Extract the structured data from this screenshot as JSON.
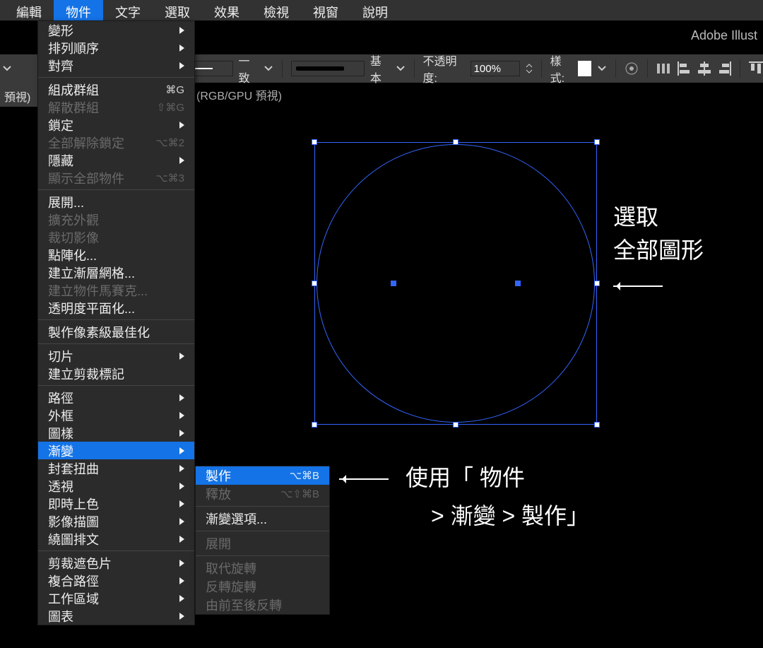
{
  "menubar": [
    "編輯",
    "物件",
    "文字",
    "選取",
    "效果",
    "檢視",
    "視窗",
    "說明"
  ],
  "activeMenuIndex": 1,
  "brand": "Adobe Illust",
  "options": {
    "uniform": "一致",
    "brush": "基本",
    "opacityLabel": "不透明度:",
    "opacityValue": "100%",
    "styleLabel": "樣式:"
  },
  "tab": {
    "left": "預視)",
    "right": "(RGB/GPU 預視)"
  },
  "menu": {
    "groups": [
      [
        {
          "l": "變形",
          "sub": true
        },
        {
          "l": "排列順序",
          "sub": true
        },
        {
          "l": "對齊",
          "sub": true
        }
      ],
      [
        {
          "l": "組成群組",
          "sc": "⌘G"
        },
        {
          "l": "解散群組",
          "sc": "⇧⌘G",
          "dis": true
        },
        {
          "l": "鎖定",
          "sub": true
        },
        {
          "l": "全部解除鎖定",
          "sc": "⌥⌘2",
          "dis": true
        },
        {
          "l": "隱藏",
          "sub": true
        },
        {
          "l": "顯示全部物件",
          "sc": "⌥⌘3",
          "dis": true
        }
      ],
      [
        {
          "l": "展開..."
        },
        {
          "l": "擴充外觀",
          "dis": true
        },
        {
          "l": "裁切影像",
          "dis": true
        },
        {
          "l": "點陣化..."
        },
        {
          "l": "建立漸層網格..."
        },
        {
          "l": "建立物件馬賽克...",
          "dis": true
        },
        {
          "l": "透明度平面化..."
        }
      ],
      [
        {
          "l": "製作像素級最佳化"
        }
      ],
      [
        {
          "l": "切片",
          "sub": true
        },
        {
          "l": "建立剪裁標記"
        }
      ],
      [
        {
          "l": "路徑",
          "sub": true
        },
        {
          "l": "外框",
          "sub": true
        },
        {
          "l": "圖樣",
          "sub": true
        },
        {
          "l": "漸變",
          "sub": true,
          "hl": true
        },
        {
          "l": "封套扭曲",
          "sub": true
        },
        {
          "l": "透視",
          "sub": true
        },
        {
          "l": "即時上色",
          "sub": true
        },
        {
          "l": "影像描圖",
          "sub": true
        },
        {
          "l": "繞圖排文",
          "sub": true
        }
      ],
      [
        {
          "l": "剪裁遮色片",
          "sub": true
        },
        {
          "l": "複合路徑",
          "sub": true
        },
        {
          "l": "工作區域",
          "sub": true
        },
        {
          "l": "圖表",
          "sub": true
        }
      ]
    ]
  },
  "submenu": [
    {
      "l": "製作",
      "sc": "⌥⌘B",
      "hl": true
    },
    {
      "l": "釋放",
      "sc": "⌥⇧⌘B",
      "dis": true
    },
    {
      "sep": true
    },
    {
      "l": "漸變選項..."
    },
    {
      "sep": true
    },
    {
      "l": "展開",
      "dis": true
    },
    {
      "sep": true
    },
    {
      "l": "取代旋轉",
      "dis": true
    },
    {
      "l": "反轉旋轉",
      "dis": true
    },
    {
      "l": "由前至後反轉",
      "dis": true
    }
  ],
  "annot": {
    "a1": "選取",
    "a2": "全部圖形",
    "b1": "使用「 物件",
    "b2": " > 漸變 > 製作」"
  }
}
